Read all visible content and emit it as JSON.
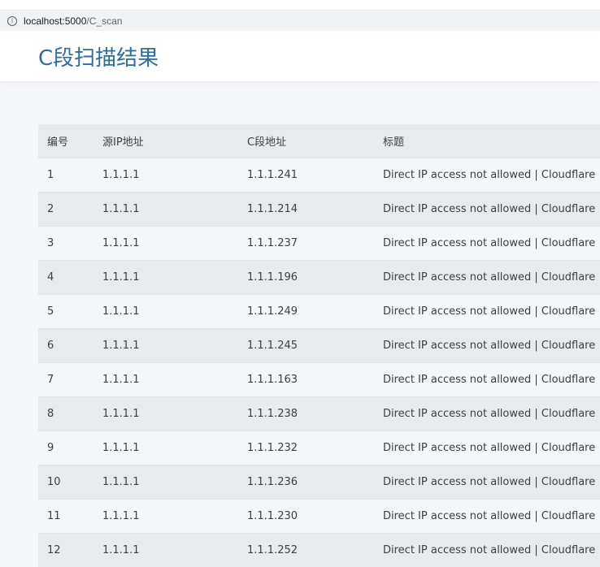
{
  "browser": {
    "url_host": "localhost:5000",
    "url_path": "/C_scan"
  },
  "page": {
    "title": "C段扫描结果"
  },
  "table": {
    "columns": [
      "编号",
      "源IP地址",
      "C段地址",
      "标题"
    ],
    "rows": [
      [
        "1",
        "1.1.1.1",
        "1.1.1.241",
        "Direct IP access not allowed | Cloudflare"
      ],
      [
        "2",
        "1.1.1.1",
        "1.1.1.214",
        "Direct IP access not allowed | Cloudflare"
      ],
      [
        "3",
        "1.1.1.1",
        "1.1.1.237",
        "Direct IP access not allowed | Cloudflare"
      ],
      [
        "4",
        "1.1.1.1",
        "1.1.1.196",
        "Direct IP access not allowed | Cloudflare"
      ],
      [
        "5",
        "1.1.1.1",
        "1.1.1.249",
        "Direct IP access not allowed | Cloudflare"
      ],
      [
        "6",
        "1.1.1.1",
        "1.1.1.245",
        "Direct IP access not allowed | Cloudflare"
      ],
      [
        "7",
        "1.1.1.1",
        "1.1.1.163",
        "Direct IP access not allowed | Cloudflare"
      ],
      [
        "8",
        "1.1.1.1",
        "1.1.1.238",
        "Direct IP access not allowed | Cloudflare"
      ],
      [
        "9",
        "1.1.1.1",
        "1.1.1.232",
        "Direct IP access not allowed | Cloudflare"
      ],
      [
        "10",
        "1.1.1.1",
        "1.1.1.236",
        "Direct IP access not allowed | Cloudflare"
      ],
      [
        "11",
        "1.1.1.1",
        "1.1.1.230",
        "Direct IP access not allowed | Cloudflare"
      ],
      [
        "12",
        "1.1.1.1",
        "1.1.1.252",
        "Direct IP access not allowed | Cloudflare"
      ]
    ]
  },
  "icons": {
    "address_info": "info-icon"
  },
  "colors": {
    "title": "#2c6ea0",
    "header_row": "#e8ebee",
    "row_odd": "#f4f6f8",
    "row_even": "#e8ebee"
  }
}
